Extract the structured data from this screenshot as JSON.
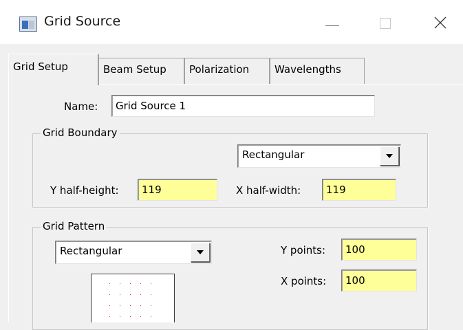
{
  "window": {
    "title": "Grid Source",
    "icon": "app-window-icon"
  },
  "tabs": [
    {
      "label": "Grid Setup",
      "active": true
    },
    {
      "label": "Beam Setup",
      "active": false
    },
    {
      "label": "Polarization",
      "active": false
    },
    {
      "label": "Wavelengths",
      "active": false
    }
  ],
  "name_field": {
    "label": "Name:",
    "value": "Grid Source 1"
  },
  "grid_boundary": {
    "title": "Grid Boundary",
    "shape": "Rectangular",
    "y_half_height_label": "Y half-height:",
    "y_half_height": "119",
    "x_half_width_label": "X half-width:",
    "x_half_width": "119"
  },
  "grid_pattern": {
    "title": "Grid Pattern",
    "shape": "Rectangular",
    "y_points_label": "Y points:",
    "y_points": "100",
    "x_points_label": "X points:",
    "x_points": "100"
  },
  "colors": {
    "input_highlight": "#ffff99",
    "preview_dots": "#e04040"
  }
}
